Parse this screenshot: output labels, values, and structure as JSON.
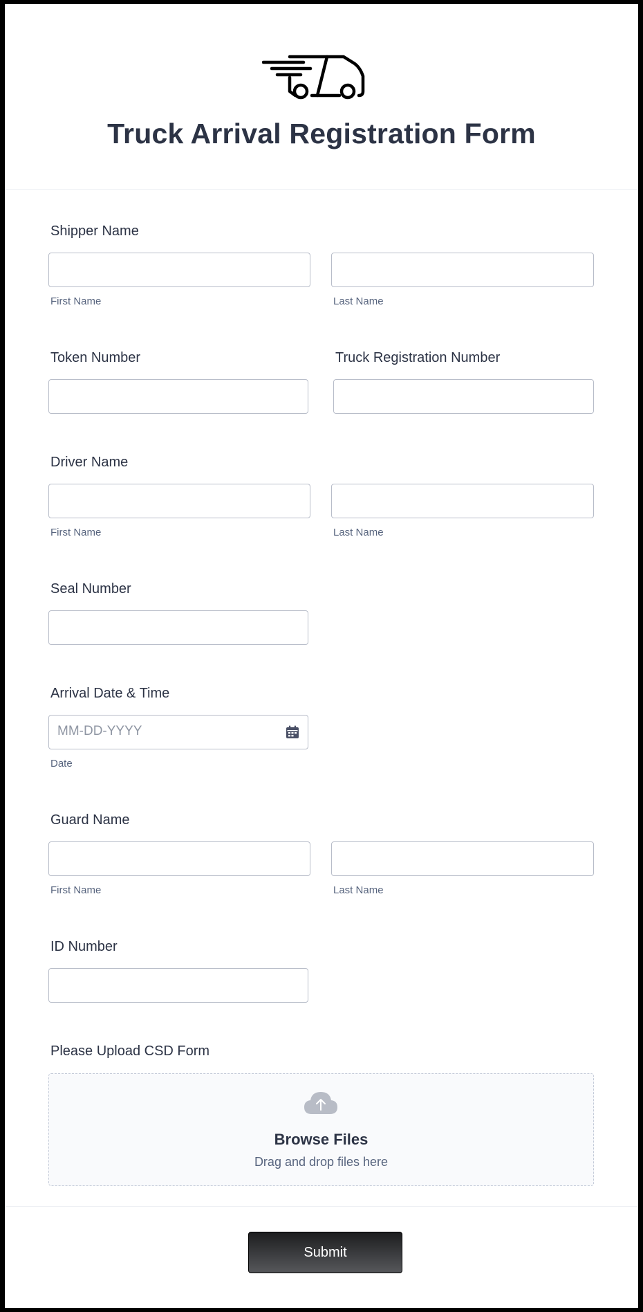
{
  "form": {
    "title": "Truck Arrival Registration Form",
    "header_icon": "truck-icon"
  },
  "fields": {
    "shipper_name": {
      "label": "Shipper Name",
      "first_sublabel": "First Name",
      "last_sublabel": "Last Name"
    },
    "token_number": {
      "label": "Token Number"
    },
    "truck_registration": {
      "label": "Truck Registration Number"
    },
    "driver_name": {
      "label": "Driver Name",
      "first_sublabel": "First Name",
      "last_sublabel": "Last Name"
    },
    "seal_number": {
      "label": "Seal Number"
    },
    "arrival": {
      "label": "Arrival Date & Time",
      "placeholder": "MM-DD-YYYY",
      "sublabel": "Date",
      "icon": "calendar-icon"
    },
    "guard_name": {
      "label": "Guard Name",
      "first_sublabel": "First Name",
      "last_sublabel": "Last Name"
    },
    "id_number": {
      "label": "ID Number"
    },
    "upload": {
      "label": "Please Upload CSD Form",
      "browse": "Browse Files",
      "hint": "Drag and drop files here",
      "icon": "cloud-upload-icon"
    }
  },
  "submit_label": "Submit",
  "colors": {
    "text": "#2c3345",
    "sublabel": "#57647e",
    "input_border": "#b8bdc9",
    "submit_bg": "#1d1d1f"
  }
}
